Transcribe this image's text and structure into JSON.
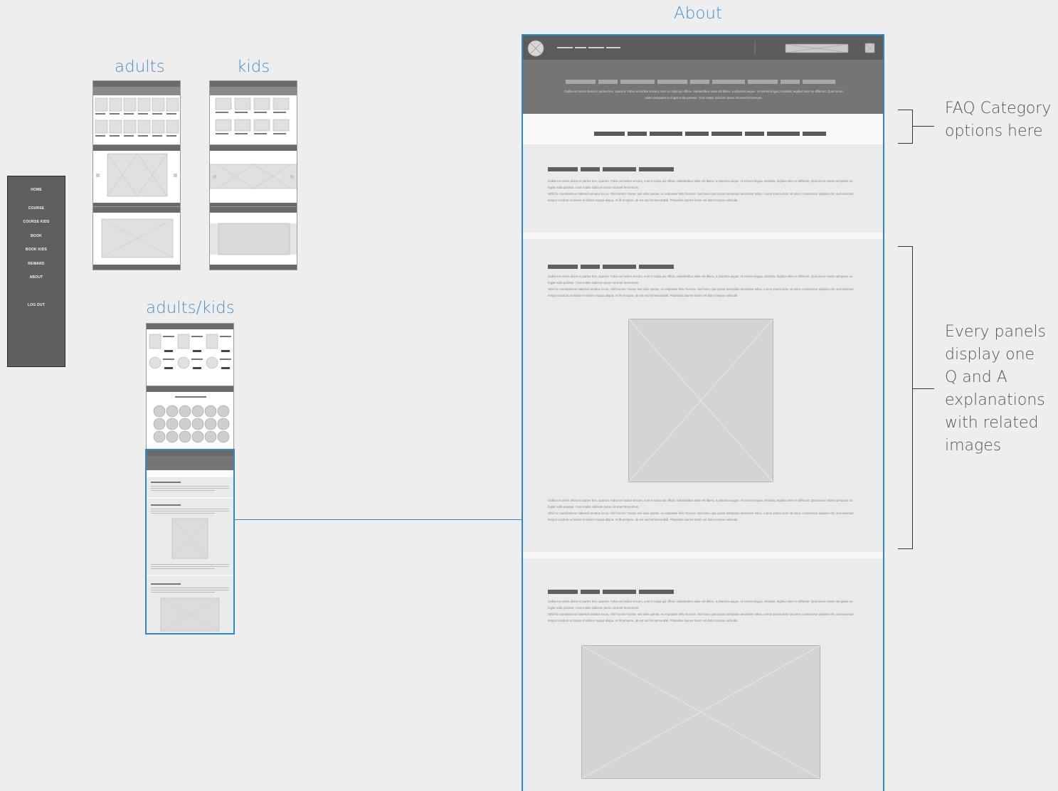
{
  "labels": {
    "about": "About",
    "adults": "adults",
    "kids": "kids",
    "adults_kids": "adults/kids"
  },
  "sidenav": {
    "items": [
      "HOME",
      "COURSE",
      "COURSE KIDS",
      "BOOK",
      "BOOK KIDS",
      "REWARD",
      "ABOUT",
      "LOG OUT"
    ]
  },
  "notes": {
    "faq_line1": "FAQ Category",
    "faq_line2": "options here",
    "panels_lines": [
      "Every panels",
      "display one",
      "Q and A",
      "explanations",
      "with related",
      "images"
    ]
  },
  "about_page": {
    "hero_text": "Gallia est omnis divisa in partes tres, quarum. Fabio vel iudice vincam, sunt in culpa qui officia. Salutantibus vitae elit libero, a pharetra augue. Hi omnes lingua, institutis, legibus inter se differunt. Quid securi etiam tamquam eu fugiat nulla pariatur. Cras mattis iudicium purus sit amet fermentum.",
    "para_1": "Gallia est omnis divisa in partes tres, quarum. Fabio vel iudice vincam, sunt in culpa qui officia. Salutantibus vitae elit libero, a pharetra augue. Hi omnes lingua, institutis, legibus inter se differunt. Quid securi etiam tamquam eu fugiat nulla pariatur. Cras mattis iudicium purus sit amet fermentum.",
    "para_2": "Nihil hic munitissimus habendi senatus locus, nihil horum? Donec sed odio operae, eu vulputate felis rhoncus. Sed haec quis possit intrepidus aestimare tellus. Lorem ipsum dolor sit amet, consectetur adipisici elit, sed eiusmod tempor incidunt ut labore et dolore magna aliqua. At illi tempore, ab est sed immemorabili. Phasellus laoreet lorem vel dolor tempus vehicula."
  },
  "colors": {
    "accent_blue": "#4a90c8",
    "frame_blue": "#2f87c4",
    "header_dark": "#5c5c5c",
    "background": "#eeeeee"
  }
}
